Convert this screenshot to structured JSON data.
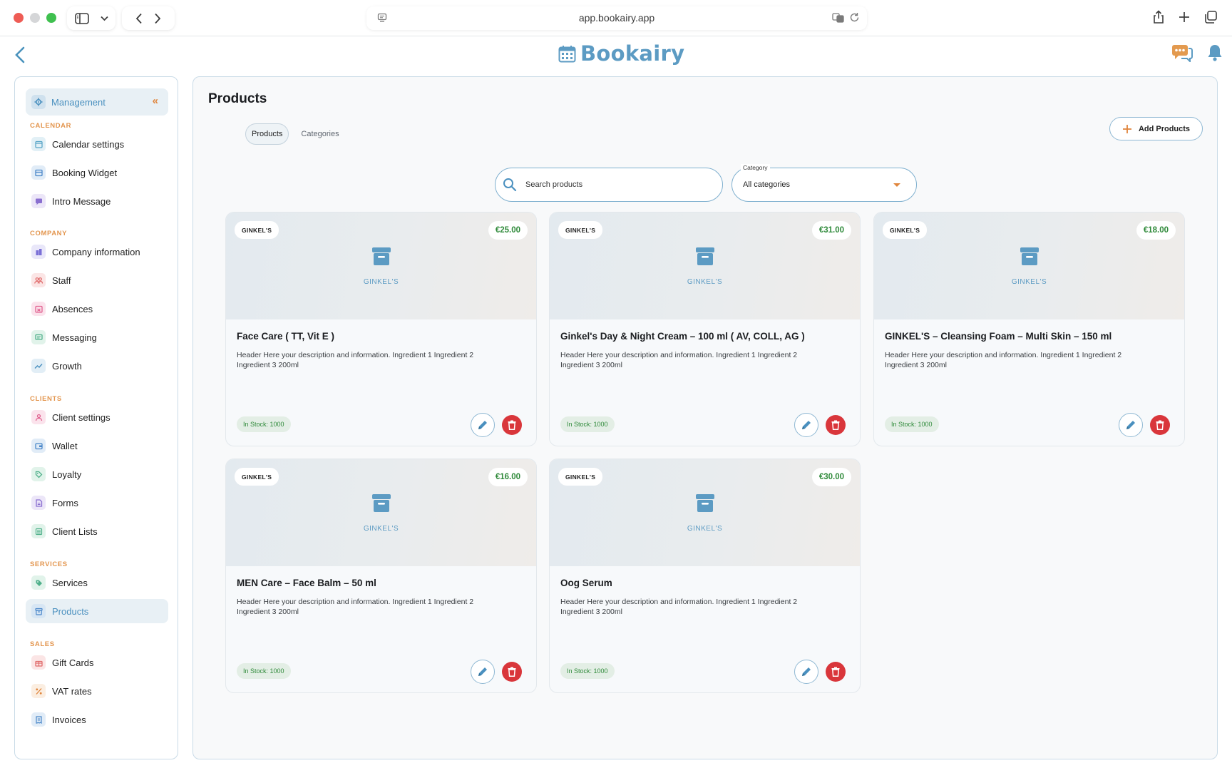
{
  "browser": {
    "url": "app.bookairy.app"
  },
  "app": {
    "logo_text": "Bookairy"
  },
  "sidebar": {
    "management_label": "Management",
    "sections": [
      {
        "title": "CALENDAR",
        "items": [
          {
            "label": "Calendar settings",
            "icon": "calendar-icon",
            "color": "#5aa6c8"
          },
          {
            "label": "Booking Widget",
            "icon": "widget-icon",
            "color": "#4a87c9"
          },
          {
            "label": "Intro Message",
            "icon": "message-icon",
            "color": "#8a6fd0"
          }
        ]
      },
      {
        "title": "COMPANY",
        "items": [
          {
            "label": "Company information",
            "icon": "building-icon",
            "color": "#7a6fd6"
          },
          {
            "label": "Staff",
            "icon": "staff-icon",
            "color": "#e06b6b"
          },
          {
            "label": "Absences",
            "icon": "absences-icon",
            "color": "#e0608f"
          },
          {
            "label": "Messaging",
            "icon": "chat-icon",
            "color": "#4fb08a"
          },
          {
            "label": "Growth",
            "icon": "growth-icon",
            "color": "#4a90bf"
          }
        ]
      },
      {
        "title": "CLIENTS",
        "items": [
          {
            "label": "Client settings",
            "icon": "client-icon",
            "color": "#e0608f"
          },
          {
            "label": "Wallet",
            "icon": "wallet-icon",
            "color": "#4a87c9"
          },
          {
            "label": "Loyalty",
            "icon": "loyalty-icon",
            "color": "#4fb08a"
          },
          {
            "label": "Forms",
            "icon": "forms-icon",
            "color": "#8a6fd0"
          },
          {
            "label": "Client Lists",
            "icon": "list-icon",
            "color": "#4fb08a"
          }
        ]
      },
      {
        "title": "SERVICES",
        "items": [
          {
            "label": "Services",
            "icon": "services-icon",
            "color": "#4fb08a"
          },
          {
            "label": "Products",
            "icon": "products-icon",
            "color": "#4a87c9",
            "active": true
          }
        ]
      },
      {
        "title": "SALES",
        "items": [
          {
            "label": "Gift Cards",
            "icon": "gift-icon",
            "color": "#e06b6b"
          },
          {
            "label": "VAT rates",
            "icon": "percent-icon",
            "color": "#e0853c"
          },
          {
            "label": "Invoices",
            "icon": "invoice-icon",
            "color": "#4a87c9"
          }
        ]
      }
    ]
  },
  "main": {
    "title": "Products",
    "tabs": [
      {
        "label": "Products",
        "active": true
      },
      {
        "label": "Categories",
        "active": false
      }
    ],
    "add_button_label": "Add Products",
    "search": {
      "placeholder": "Search products"
    },
    "category_filter": {
      "legend": "Category",
      "value": "All categories"
    },
    "products": [
      {
        "brand": "GINKEL'S",
        "price": "€25.00",
        "image_caption": "GINKEL'S",
        "name": "Face Care ( TT, Vit E )",
        "description": "Header Here your description and information. Ingredient 1 Ingredient 2 Ingredient 3 200ml",
        "stock": "In Stock: 1000"
      },
      {
        "brand": "GINKEL'S",
        "price": "€31.00",
        "image_caption": "GINKEL'S",
        "name": "Ginkel's Day & Night Cream – 100 ml ( AV, COLL, AG )",
        "description": "Header Here your description and information. Ingredient 1 Ingredient 2 Ingredient 3 200ml",
        "stock": "In Stock: 1000"
      },
      {
        "brand": "GINKEL'S",
        "price": "€18.00",
        "image_caption": "GINKEL'S",
        "name": "GINKEL'S – Cleansing Foam – Multi Skin – 150 ml",
        "description": "Header Here your description and information. Ingredient 1 Ingredient 2 Ingredient 3 200ml",
        "stock": "In Stock: 1000"
      },
      {
        "brand": "GINKEL'S",
        "price": "€16.00",
        "image_caption": "GINKEL'S",
        "name": "MEN Care – Face Balm – 50 ml",
        "description": "Header Here your description and information. Ingredient 1 Ingredient 2 Ingredient 3 200ml",
        "stock": "In Stock: 1000"
      },
      {
        "brand": "GINKEL'S",
        "price": "€30.00",
        "image_caption": "GINKEL'S",
        "name": "Oog Serum",
        "description": "Header Here your description and information. Ingredient 1 Ingredient 2 Ingredient 3 200ml",
        "stock": "In Stock: 1000"
      }
    ]
  },
  "colors": {
    "accent": "#5c9bc3",
    "section_title": "#e3964f",
    "price": "#2f8a3a",
    "delete": "#d9363b"
  }
}
